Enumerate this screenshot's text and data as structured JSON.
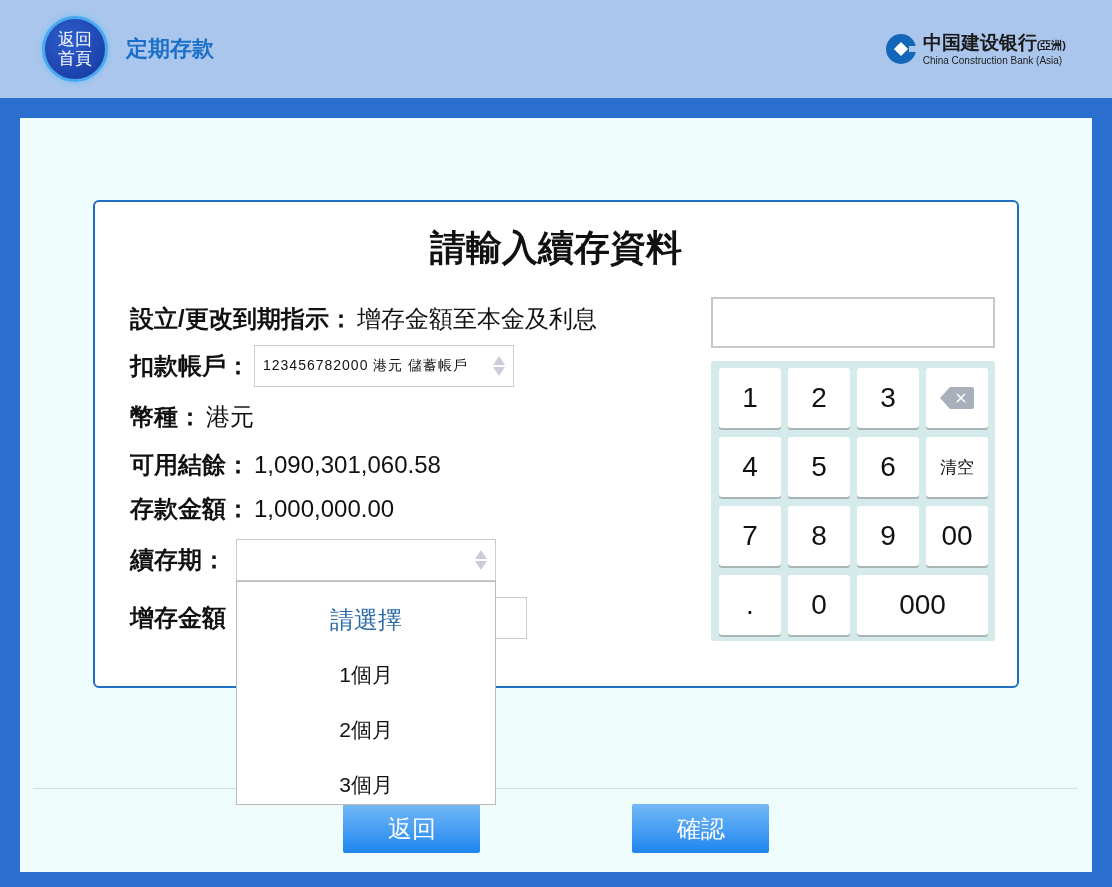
{
  "header": {
    "home_button": "返回首頁",
    "title": "定期存款",
    "logo": {
      "name_zh": "中国建设银行",
      "region": "(亞洲)",
      "name_en": "China Construction Bank (Asia)"
    }
  },
  "form": {
    "title": "請輸入續存資料",
    "rows": [
      {
        "kind": "text",
        "label": "設立/更改到期指示：",
        "value": "增存金額至本金及利息"
      },
      {
        "kind": "select",
        "label": "扣款帳戶：",
        "value": "123456782000 港元 儲蓄帳戶"
      },
      {
        "kind": "text",
        "label": "幣種：",
        "value": "港元"
      },
      {
        "kind": "text",
        "label": "可用結餘：",
        "value": "1,090,301,060.58"
      },
      {
        "kind": "text",
        "label": "存款金額：",
        "value": "1,000,000.00"
      },
      {
        "kind": "dropdown",
        "label": "續存期：",
        "options": [
          {
            "label": "請選擇",
            "selected": true
          },
          {
            "label": "1個月",
            "selected": false
          },
          {
            "label": "2個月",
            "selected": false
          },
          {
            "label": "3個月",
            "selected": false
          }
        ]
      },
      {
        "kind": "input",
        "label": "增存金額"
      }
    ]
  },
  "keypad": {
    "keys": [
      {
        "kind": "key",
        "label": "1"
      },
      {
        "kind": "key",
        "label": "2"
      },
      {
        "kind": "key",
        "label": "3"
      },
      {
        "kind": "backspace"
      },
      {
        "kind": "key",
        "label": "4"
      },
      {
        "kind": "key",
        "label": "5"
      },
      {
        "kind": "key",
        "label": "6"
      },
      {
        "kind": "small",
        "label": "清空"
      },
      {
        "kind": "key",
        "label": "7"
      },
      {
        "kind": "key",
        "label": "8"
      },
      {
        "kind": "key",
        "label": "9"
      },
      {
        "kind": "key",
        "label": "00"
      },
      {
        "kind": "key",
        "label": "."
      },
      {
        "kind": "key",
        "label": "0"
      },
      {
        "kind": "wide",
        "label": "000"
      }
    ]
  },
  "buttons": [
    "返回",
    "確認"
  ]
}
